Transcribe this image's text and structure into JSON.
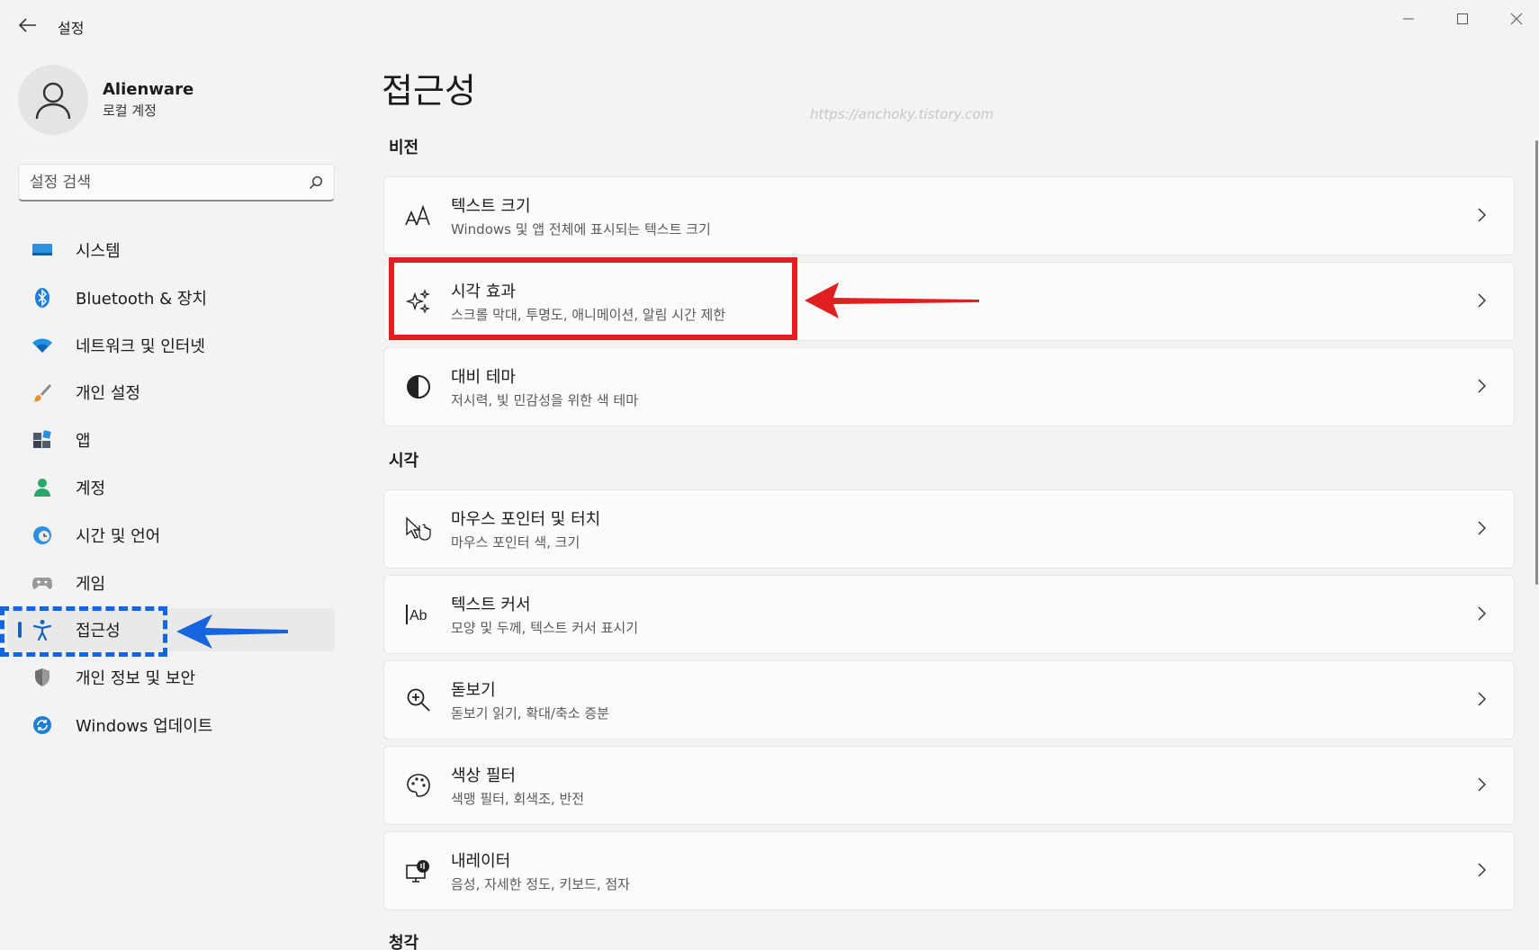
{
  "window": {
    "title": "설정",
    "accent_color": "#1565c0"
  },
  "profile": {
    "name": "Alienware",
    "account_type": "로컬 계정"
  },
  "search": {
    "placeholder": "설정 검색"
  },
  "sidebar": {
    "items": [
      {
        "label": "시스템",
        "icon": "system-icon",
        "active": false
      },
      {
        "label": "Bluetooth & 장치",
        "icon": "bluetooth-icon",
        "active": false
      },
      {
        "label": "네트워크 및 인터넷",
        "icon": "wifi-icon",
        "active": false
      },
      {
        "label": "개인 설정",
        "icon": "brush-icon",
        "active": false
      },
      {
        "label": "앱",
        "icon": "apps-icon",
        "active": false
      },
      {
        "label": "계정",
        "icon": "account-icon",
        "active": false
      },
      {
        "label": "시간 및 언어",
        "icon": "globe-clock-icon",
        "active": false
      },
      {
        "label": "게임",
        "icon": "gamepad-icon",
        "active": false
      },
      {
        "label": "접근성",
        "icon": "accessibility-icon",
        "active": true
      },
      {
        "label": "개인 정보 및 보안",
        "icon": "shield-icon",
        "active": false
      },
      {
        "label": "Windows 업데이트",
        "icon": "update-icon",
        "active": false
      }
    ]
  },
  "main": {
    "title": "접근성",
    "watermark": "https://anchoky.tistory.com",
    "sections": [
      {
        "title": "비전",
        "cards": [
          {
            "title": "텍스트 크기",
            "subtitle": "Windows 및 앱 전체에 표시되는 텍스트 크기",
            "icon": "text-size-icon"
          },
          {
            "title": "시각 효과",
            "subtitle": "스크롤 막대, 투명도, 애니메이션, 알림 시간 제한",
            "icon": "sparkle-icon"
          },
          {
            "title": "대비 테마",
            "subtitle": "저시력, 빛 민감성을 위한 색 테마",
            "icon": "contrast-icon"
          }
        ]
      },
      {
        "title": "시각",
        "cards": [
          {
            "title": "마우스 포인터 및 터치",
            "subtitle": "마우스 포인터 색, 크기",
            "icon": "pointer-touch-icon"
          },
          {
            "title": "텍스트 커서",
            "subtitle": "모양 및 두께, 텍스트 커서 표시기",
            "icon": "text-cursor-icon"
          },
          {
            "title": "돋보기",
            "subtitle": "돋보기 읽기, 확대/축소 증분",
            "icon": "magnifier-icon"
          },
          {
            "title": "색상 필터",
            "subtitle": "색맹 필터, 회색조, 반전",
            "icon": "palette-icon"
          },
          {
            "title": "내레이터",
            "subtitle": "음성, 자세한 정도, 키보드, 점자",
            "icon": "narrator-icon"
          }
        ]
      },
      {
        "title": "청각",
        "cards": []
      }
    ]
  },
  "annotations": {
    "highlight_color": "#e02020",
    "nav_highlight_color": "#1565e0"
  }
}
